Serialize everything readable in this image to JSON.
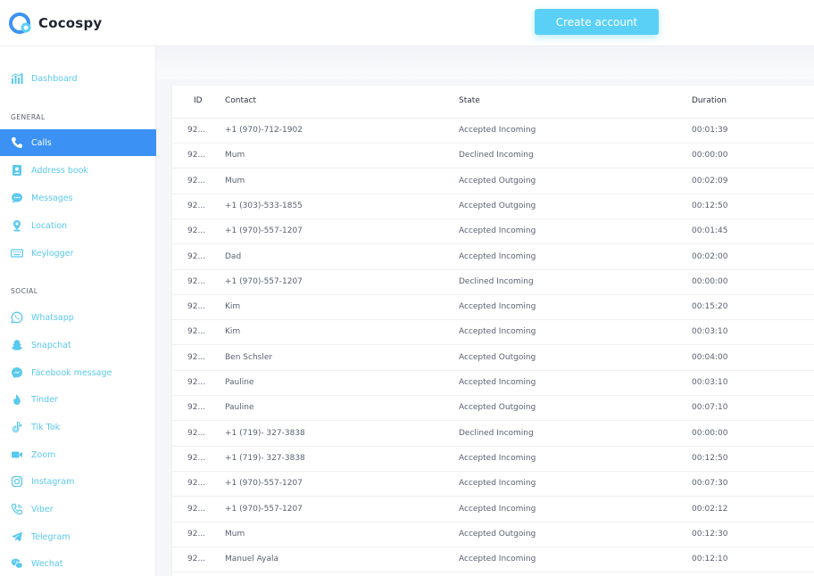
{
  "app": {
    "name": "Cocospy",
    "create_account_label": "Create account"
  },
  "colors": {
    "accent": "#5ad0f7",
    "active": "#3b92f4",
    "nav_text": "#5ac9ee"
  },
  "sidebar": {
    "dashboard": {
      "label": "Dashboard",
      "icon": "bar-chart-icon"
    },
    "general_title": "GENERAL",
    "general": [
      {
        "label": "Calls",
        "icon": "phone-icon",
        "active": true
      },
      {
        "label": "Address book",
        "icon": "contact-card-icon"
      },
      {
        "label": "Messages",
        "icon": "chat-bubble-icon"
      },
      {
        "label": "Location",
        "icon": "map-pin-icon"
      },
      {
        "label": "Keylogger",
        "icon": "keyboard-icon"
      }
    ],
    "social_title": "SOCIAL",
    "social": [
      {
        "label": "Whatsapp",
        "icon": "whatsapp-icon"
      },
      {
        "label": "Snapchat",
        "icon": "snapchat-icon"
      },
      {
        "label": "Facebook message",
        "icon": "messenger-icon"
      },
      {
        "label": "Tinder",
        "icon": "flame-icon"
      },
      {
        "label": "Tik Tok",
        "icon": "tiktok-icon"
      },
      {
        "label": "Zoom",
        "icon": "video-camera-icon"
      },
      {
        "label": "Instagram",
        "icon": "instagram-icon"
      },
      {
        "label": "Viber",
        "icon": "viber-icon"
      },
      {
        "label": "Telegram",
        "icon": "paper-plane-icon"
      },
      {
        "label": "Wechat",
        "icon": "wechat-icon"
      }
    ]
  },
  "table": {
    "headers": {
      "id": "ID",
      "contact": "Contact",
      "state": "State",
      "duration": "Duration"
    },
    "rows": [
      {
        "id": "92...",
        "contact": "+1 (970)-712-1902",
        "state": "Accepted Incoming",
        "duration": "00:01:39"
      },
      {
        "id": "92...",
        "contact": "Mum",
        "state": "Declined Incoming",
        "duration": "00:00:00"
      },
      {
        "id": "92...",
        "contact": "Mum",
        "state": "Accepted Outgoing",
        "duration": "00:02:09"
      },
      {
        "id": "92...",
        "contact": "+1 (303)-533-1855",
        "state": "Accepted Outgoing",
        "duration": "00:12:50"
      },
      {
        "id": "92...",
        "contact": "+1 (970)-557-1207",
        "state": "Accepted Incoming",
        "duration": "00:01:45"
      },
      {
        "id": "92...",
        "contact": "Dad",
        "state": "Accepted Incoming",
        "duration": "00:02:00"
      },
      {
        "id": "92...",
        "contact": "+1 (970)-557-1207",
        "state": "Declined Incoming",
        "duration": "00:00:00"
      },
      {
        "id": "92...",
        "contact": "Kim",
        "state": "Accepted Incoming",
        "duration": "00:15:20"
      },
      {
        "id": "92...",
        "contact": "Kim",
        "state": "Accepted Incoming",
        "duration": "00:03:10"
      },
      {
        "id": "92...",
        "contact": "Ben Schsler",
        "state": "Accepted Outgoing",
        "duration": "00:04:00"
      },
      {
        "id": "92...",
        "contact": "Pauline",
        "state": "Accepted Incoming",
        "duration": "00:03:10"
      },
      {
        "id": "92...",
        "contact": "Pauline",
        "state": "Accepted Outgoing",
        "duration": "00:07:10"
      },
      {
        "id": "92...",
        "contact": "+1 (719)- 327-3838",
        "state": "Declined Incoming",
        "duration": "00:00:00"
      },
      {
        "id": "92...",
        "contact": "+1 (719)- 327-3838",
        "state": "Accepted Incoming",
        "duration": "00:12:50"
      },
      {
        "id": "92...",
        "contact": "+1 (970)-557-1207",
        "state": "Accepted Incoming",
        "duration": "00:07:30"
      },
      {
        "id": "92...",
        "contact": "+1 (970)-557-1207",
        "state": "Accepted Incoming",
        "duration": "00:02:12"
      },
      {
        "id": "92...",
        "contact": "Mum",
        "state": "Accepted Outgoing",
        "duration": "00:12:30"
      },
      {
        "id": "92...",
        "contact": "Manuel Ayala",
        "state": "Accepted Incoming",
        "duration": "00:12:10"
      }
    ]
  }
}
